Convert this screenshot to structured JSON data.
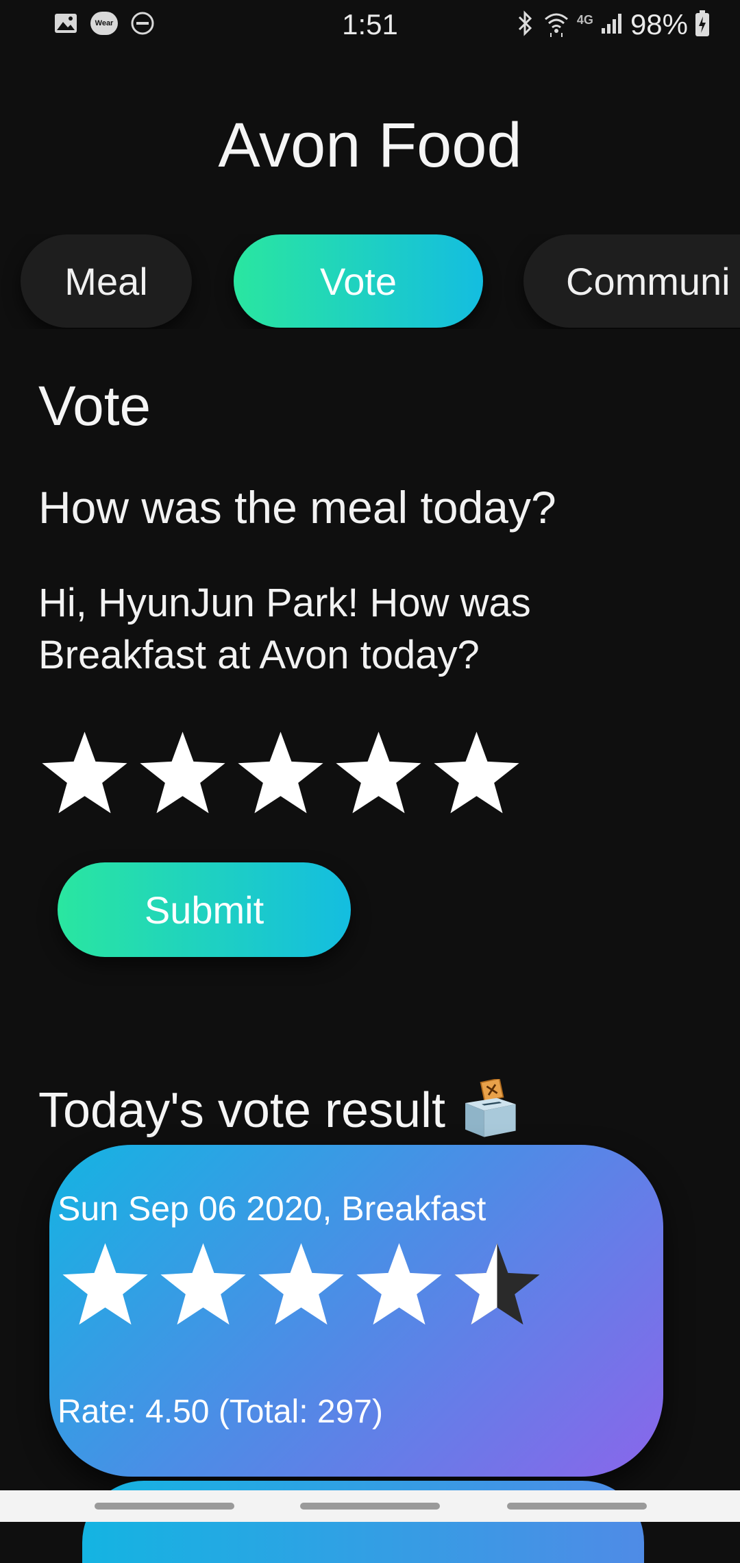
{
  "status_bar": {
    "time": "1:51",
    "battery": "98%",
    "network_label": "4G",
    "left_icons": [
      "gallery-icon",
      "wear-icon",
      "do-not-disturb-icon"
    ],
    "wear_label": "Wear",
    "right_icons": [
      "bluetooth-icon",
      "wifi-icon",
      "signal-icon",
      "battery-charging-icon"
    ]
  },
  "app": {
    "title": "Avon Food"
  },
  "tabs": [
    {
      "label": "Meal",
      "selected": false
    },
    {
      "label": "Vote",
      "selected": true
    },
    {
      "label": "Communi",
      "selected": false
    }
  ],
  "vote": {
    "section_title": "Vote",
    "question": "How was the meal today?",
    "greeting": "Hi, HyunJun Park! How was Breakfast at Avon today?",
    "star_count": 5,
    "selected_rating": 5,
    "submit_label": "Submit"
  },
  "results": {
    "title": "Today's vote result",
    "title_icon": "ballot-box-icon",
    "cards": [
      {
        "date_meal": "Sun Sep 06 2020, Breakfast",
        "stars_value": 4.5,
        "stars_max": 5,
        "rate_text": "Rate: 4.50 (Total: 297)"
      }
    ]
  },
  "colors": {
    "background": "#0f0f0f",
    "tab_default": "#1e1e1e",
    "accent_gradient_start": "#2ae6a0",
    "accent_gradient_end": "#14bde0",
    "card_gradient_start": "#14b4e2",
    "card_gradient_end": "#8a66ea",
    "empty_star": "#2a2a2a"
  }
}
